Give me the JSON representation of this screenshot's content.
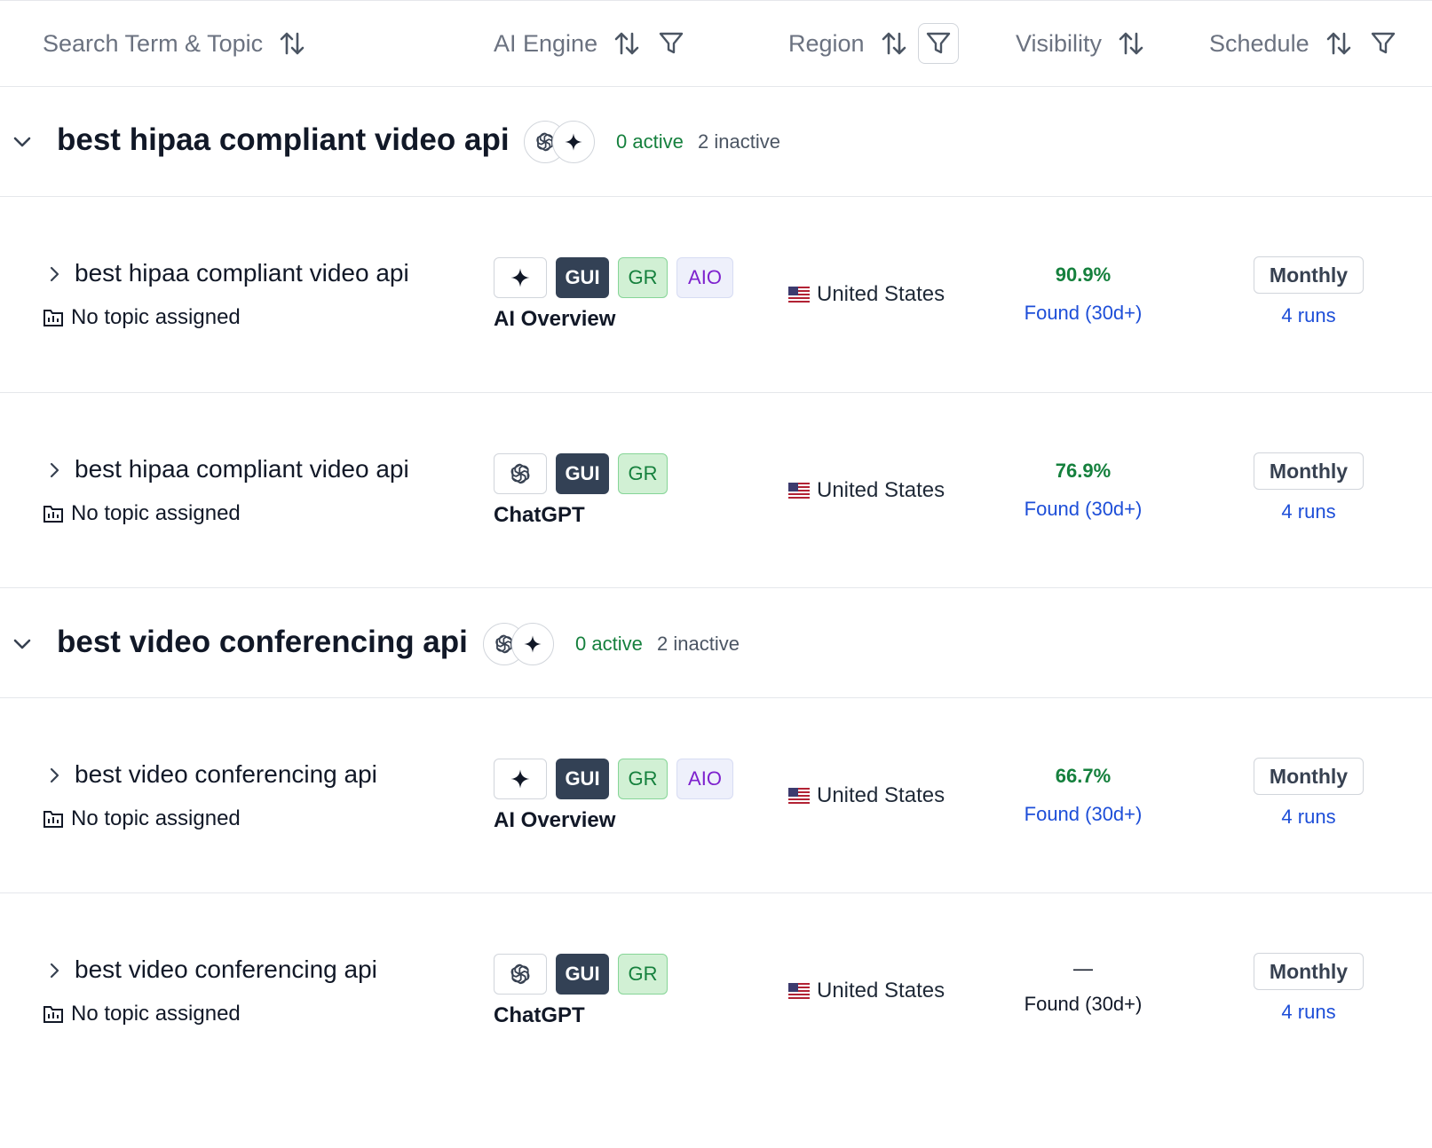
{
  "header": {
    "columns": [
      {
        "label": "Search Term & Topic"
      },
      {
        "label": "AI Engine"
      },
      {
        "label": "Region"
      },
      {
        "label": "Visibility"
      },
      {
        "label": "Schedule"
      }
    ]
  },
  "groups": [
    {
      "title": "best hipaa compliant video api",
      "active": "0 active",
      "inactive": "2 inactive",
      "icons": [
        "openai-icon",
        "sparkle-icon"
      ],
      "rows": [
        {
          "term": "best hipaa compliant video api",
          "topic": "No topic assigned",
          "engine_icon": "sparkle-icon",
          "badges": [
            "GUI",
            "GR",
            "AIO"
          ],
          "engine": "AI Overview",
          "region": "United States",
          "visibility": "90.9%",
          "found": "Found (30d+)",
          "schedule": "Monthly",
          "runs": "4 runs"
        },
        {
          "term": "best hipaa compliant video api",
          "topic": "No topic assigned",
          "engine_icon": "openai-icon",
          "badges": [
            "GUI",
            "GR"
          ],
          "engine": "ChatGPT",
          "region": "United States",
          "visibility": "76.9%",
          "found": "Found (30d+)",
          "schedule": "Monthly",
          "runs": "4 runs"
        }
      ]
    },
    {
      "title": "best video conferencing api",
      "active": "0 active",
      "inactive": "2 inactive",
      "icons": [
        "openai-icon",
        "sparkle-icon"
      ],
      "rows": [
        {
          "term": "best video conferencing api",
          "topic": "No topic assigned",
          "engine_icon": "sparkle-icon",
          "badges": [
            "GUI",
            "GR",
            "AIO"
          ],
          "engine": "AI Overview",
          "region": "United States",
          "visibility": "66.7%",
          "found": "Found (30d+)",
          "schedule": "Monthly",
          "runs": "4 runs"
        },
        {
          "term": "best video conferencing api",
          "topic": "No topic assigned",
          "engine_icon": "openai-icon",
          "badges": [
            "GUI",
            "GR"
          ],
          "engine": "ChatGPT",
          "region": "United States",
          "visibility": "—",
          "found": "Found (30d+)",
          "schedule": "Monthly",
          "runs": "4 runs"
        }
      ]
    }
  ],
  "colors": {
    "active_green": "#15803d",
    "link_blue": "#1d4ed8",
    "gui_badge": "#334155",
    "aio_purple": "#7e22ce"
  }
}
